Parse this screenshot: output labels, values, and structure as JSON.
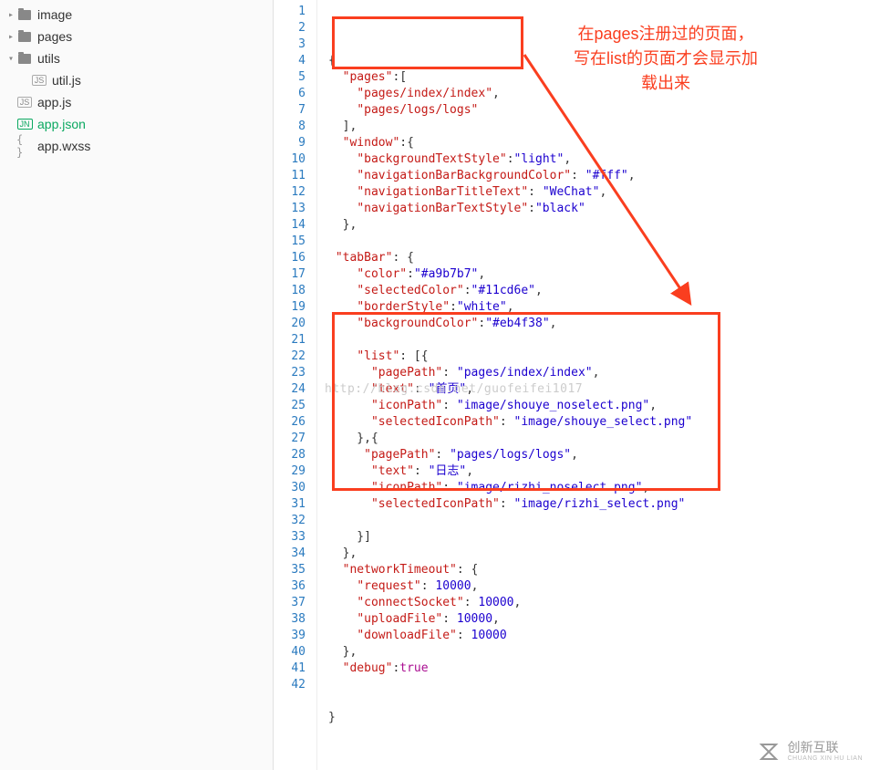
{
  "sidebar": {
    "items": [
      {
        "label": "image",
        "type": "folder",
        "indent": 0,
        "arrow": "▸"
      },
      {
        "label": "pages",
        "type": "folder",
        "indent": 0,
        "arrow": "▸"
      },
      {
        "label": "utils",
        "type": "folder",
        "indent": 0,
        "arrow": "▾"
      },
      {
        "label": "util.js",
        "type": "js",
        "indent": 1,
        "badge": "JS"
      },
      {
        "label": "app.js",
        "type": "js",
        "indent": 0,
        "badge": "JS"
      },
      {
        "label": "app.json",
        "type": "json",
        "indent": 0,
        "badge": "JN",
        "active": true
      },
      {
        "label": "app.wxss",
        "type": "wxss",
        "indent": 0,
        "badge": "{ }"
      }
    ]
  },
  "code": {
    "lines": [
      [
        [
          "p",
          "{"
        ]
      ],
      [
        [
          "p",
          "  "
        ],
        [
          "k",
          "\"pages\""
        ],
        [
          "p",
          ":["
        ]
      ],
      [
        [
          "p",
          "    "
        ],
        [
          "k",
          "\"pages/index/index\""
        ],
        [
          "p",
          ","
        ]
      ],
      [
        [
          "p",
          "    "
        ],
        [
          "k",
          "\"pages/logs/logs\""
        ]
      ],
      [
        [
          "p",
          "  ],"
        ]
      ],
      [
        [
          "p",
          "  "
        ],
        [
          "k",
          "\"window\""
        ],
        [
          "p",
          ":{"
        ]
      ],
      [
        [
          "p",
          "    "
        ],
        [
          "k",
          "\"backgroundTextStyle\""
        ],
        [
          "p",
          ":"
        ],
        [
          "s",
          "\"light\""
        ],
        [
          "p",
          ","
        ]
      ],
      [
        [
          "p",
          "    "
        ],
        [
          "k",
          "\"navigationBarBackgroundColor\""
        ],
        [
          "p",
          ": "
        ],
        [
          "s",
          "\"#fff\""
        ],
        [
          "p",
          ","
        ]
      ],
      [
        [
          "p",
          "    "
        ],
        [
          "k",
          "\"navigationBarTitleText\""
        ],
        [
          "p",
          ": "
        ],
        [
          "s",
          "\"WeChat\""
        ],
        [
          "p",
          ","
        ]
      ],
      [
        [
          "p",
          "    "
        ],
        [
          "k",
          "\"navigationBarTextStyle\""
        ],
        [
          "p",
          ":"
        ],
        [
          "s",
          "\"black\""
        ]
      ],
      [
        [
          "p",
          "  },"
        ]
      ],
      [],
      [
        [
          "p",
          " "
        ],
        [
          "k",
          "\"tabBar\""
        ],
        [
          "p",
          ": {"
        ]
      ],
      [
        [
          "p",
          "    "
        ],
        [
          "k",
          "\"color\""
        ],
        [
          "p",
          ":"
        ],
        [
          "s",
          "\"#a9b7b7\""
        ],
        [
          "p",
          ","
        ]
      ],
      [
        [
          "p",
          "    "
        ],
        [
          "k",
          "\"selectedColor\""
        ],
        [
          "p",
          ":"
        ],
        [
          "s",
          "\"#11cd6e\""
        ],
        [
          "p",
          ","
        ]
      ],
      [
        [
          "p",
          "    "
        ],
        [
          "k",
          "\"borderStyle\""
        ],
        [
          "p",
          ":"
        ],
        [
          "s",
          "\"white\""
        ],
        [
          "p",
          ","
        ]
      ],
      [
        [
          "p",
          "    "
        ],
        [
          "k",
          "\"backgroundColor\""
        ],
        [
          "p",
          ":"
        ],
        [
          "s",
          "\"#eb4f38\""
        ],
        [
          "p",
          ","
        ]
      ],
      [],
      [
        [
          "p",
          "    "
        ],
        [
          "k",
          "\"list\""
        ],
        [
          "p",
          ": [{"
        ]
      ],
      [
        [
          "p",
          "      "
        ],
        [
          "k",
          "\"pagePath\""
        ],
        [
          "p",
          ": "
        ],
        [
          "s",
          "\"pages/index/index\""
        ],
        [
          "p",
          ","
        ]
      ],
      [
        [
          "p",
          "      "
        ],
        [
          "k",
          "\"text\""
        ],
        [
          "p",
          ": "
        ],
        [
          "s",
          "\"首页\""
        ],
        [
          "p",
          ","
        ]
      ],
      [
        [
          "p",
          "      "
        ],
        [
          "k",
          "\"iconPath\""
        ],
        [
          "p",
          ": "
        ],
        [
          "s",
          "\"image/shouye_noselect.png\""
        ],
        [
          "p",
          ","
        ]
      ],
      [
        [
          "p",
          "      "
        ],
        [
          "k",
          "\"selectedIconPath\""
        ],
        [
          "p",
          ": "
        ],
        [
          "s",
          "\"image/shouye_select.png\""
        ]
      ],
      [
        [
          "p",
          "    },{"
        ]
      ],
      [
        [
          "p",
          "     "
        ],
        [
          "k",
          "\"pagePath\""
        ],
        [
          "p",
          ": "
        ],
        [
          "s",
          "\"pages/logs/logs\""
        ],
        [
          "p",
          ","
        ]
      ],
      [
        [
          "p",
          "      "
        ],
        [
          "k",
          "\"text\""
        ],
        [
          "p",
          ": "
        ],
        [
          "s",
          "\"日志\""
        ],
        [
          "p",
          ","
        ]
      ],
      [
        [
          "p",
          "      "
        ],
        [
          "k",
          "\"iconPath\""
        ],
        [
          "p",
          ": "
        ],
        [
          "s",
          "\"image/rizhi_noselect.png\""
        ],
        [
          "p",
          ","
        ]
      ],
      [
        [
          "p",
          "      "
        ],
        [
          "k",
          "\"selectedIconPath\""
        ],
        [
          "p",
          ": "
        ],
        [
          "s",
          "\"image/rizhi_select.png\""
        ]
      ],
      [],
      [
        [
          "p",
          "    }]"
        ]
      ],
      [
        [
          "p",
          "  },"
        ]
      ],
      [
        [
          "p",
          "  "
        ],
        [
          "k",
          "\"networkTimeout\""
        ],
        [
          "p",
          ": {"
        ]
      ],
      [
        [
          "p",
          "    "
        ],
        [
          "k",
          "\"request\""
        ],
        [
          "p",
          ": "
        ],
        [
          "n",
          "10000"
        ],
        [
          "p",
          ","
        ]
      ],
      [
        [
          "p",
          "    "
        ],
        [
          "k",
          "\"connectSocket\""
        ],
        [
          "p",
          ": "
        ],
        [
          "n",
          "10000"
        ],
        [
          "p",
          ","
        ]
      ],
      [
        [
          "p",
          "    "
        ],
        [
          "k",
          "\"uploadFile\""
        ],
        [
          "p",
          ": "
        ],
        [
          "n",
          "10000"
        ],
        [
          "p",
          ","
        ]
      ],
      [
        [
          "p",
          "    "
        ],
        [
          "k",
          "\"downloadFile\""
        ],
        [
          "p",
          ": "
        ],
        [
          "n",
          "10000"
        ]
      ],
      [
        [
          "p",
          "  },"
        ]
      ],
      [
        [
          "p",
          "  "
        ],
        [
          "k",
          "\"debug\""
        ],
        [
          "p",
          ":"
        ],
        [
          "b",
          "true"
        ]
      ],
      [],
      [],
      [
        [
          "p",
          "}"
        ]
      ],
      []
    ]
  },
  "annotation": {
    "line1": "在pages注册过的页面，",
    "line2": "写在list的页面才会显示加",
    "line3": "载出来"
  },
  "ghost_url": "http://blog.csdn.net/guofeifei1017",
  "watermark": "创新互联"
}
